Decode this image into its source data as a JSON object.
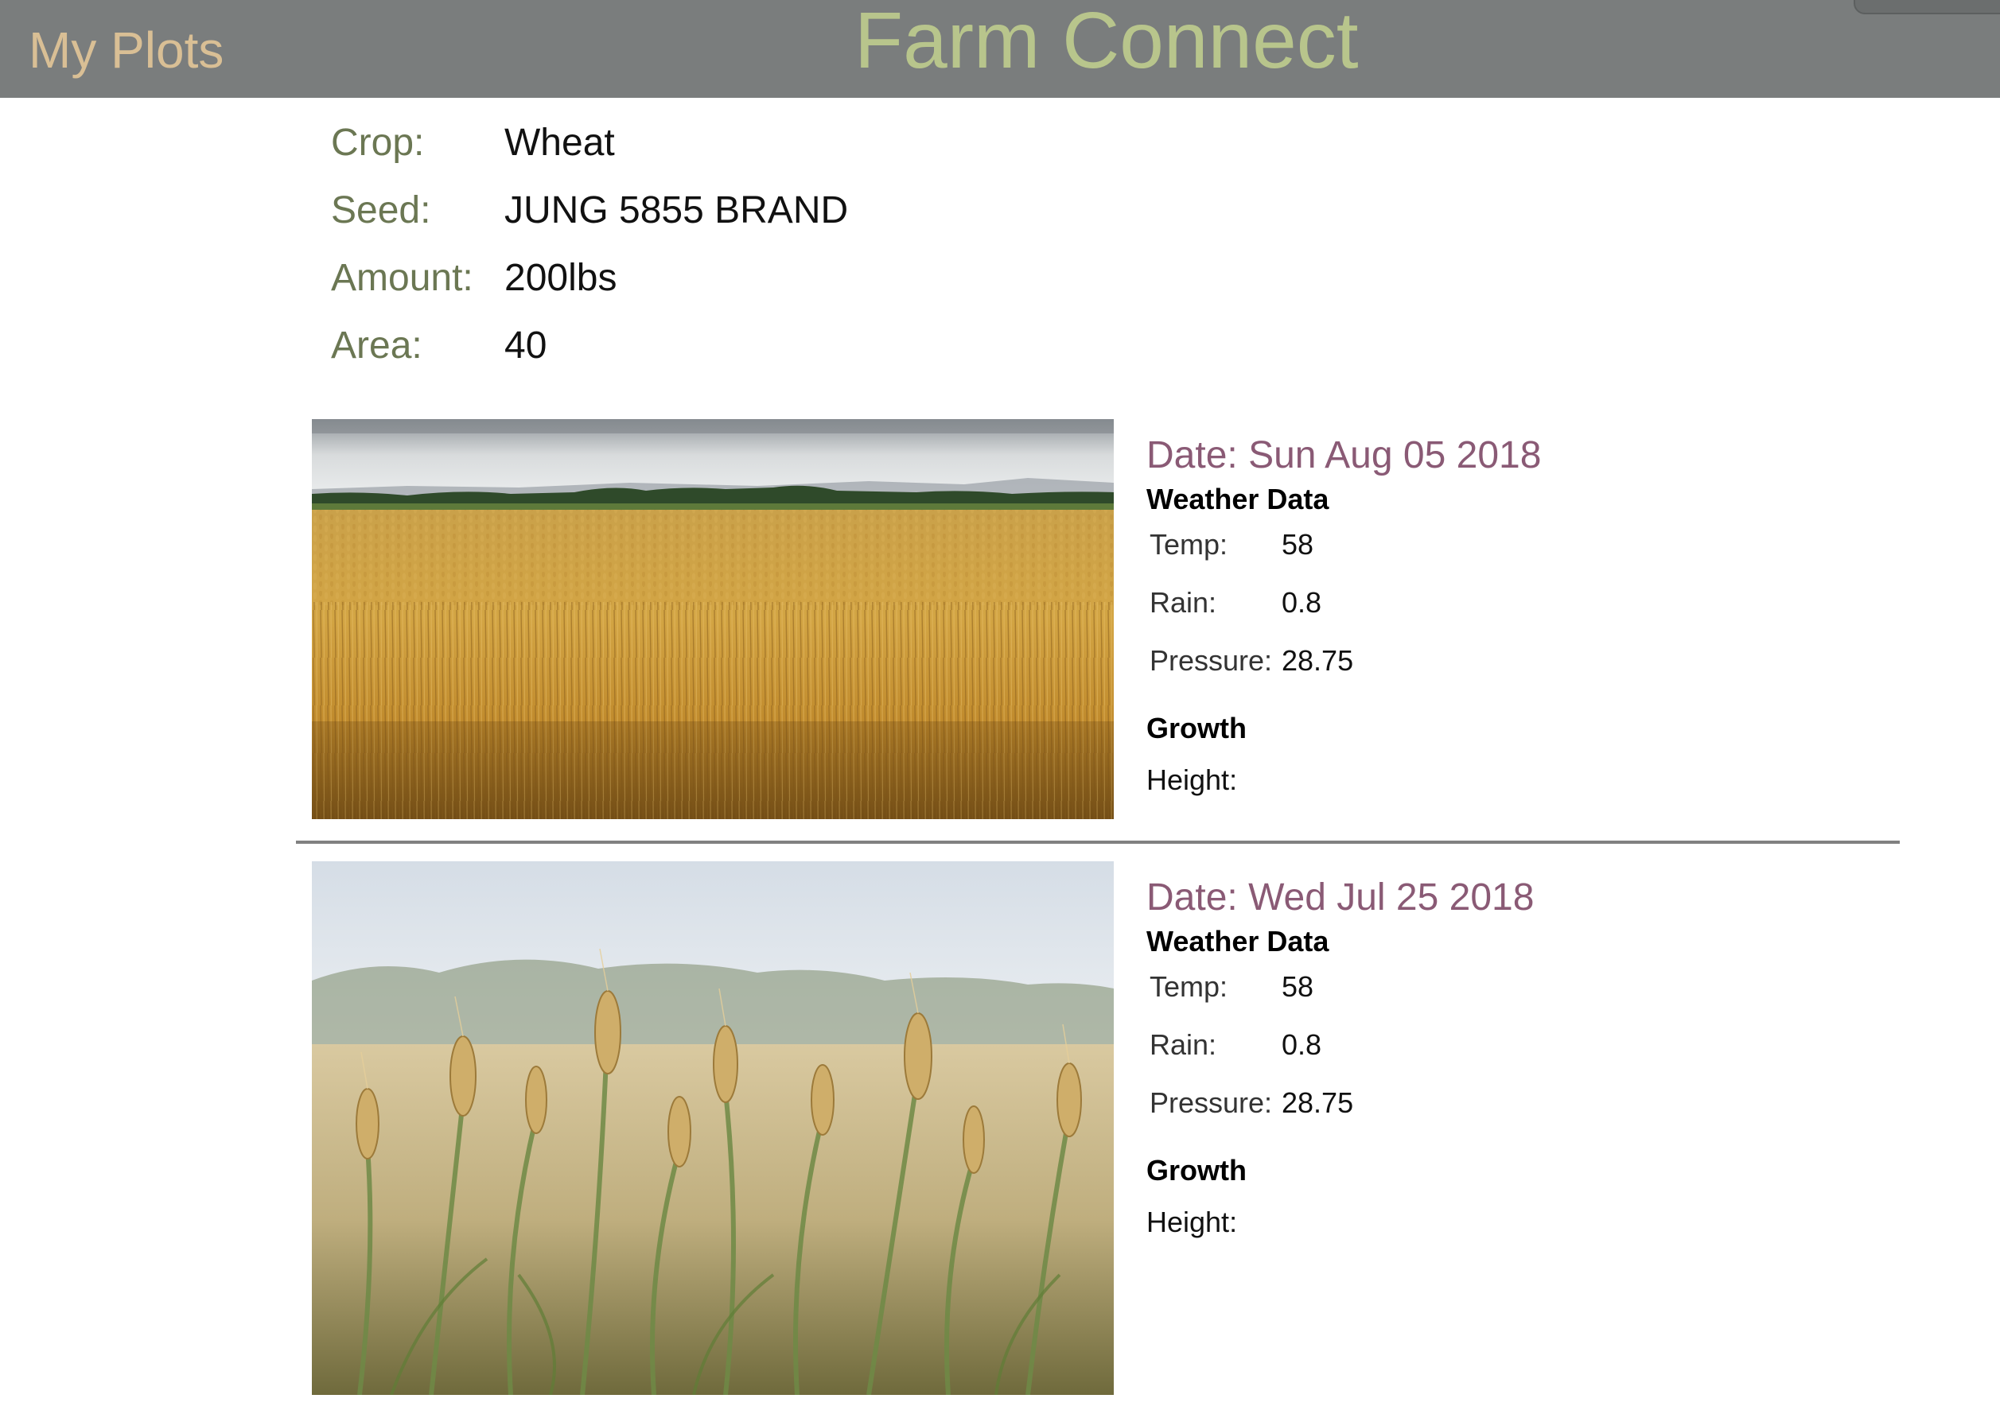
{
  "header": {
    "nav_link": "My Plots",
    "title": "Farm Connect"
  },
  "plot": {
    "crop_label": "Crop:",
    "crop_value": "Wheat",
    "seed_label": "Seed:",
    "seed_value": "JUNG 5855 BRAND",
    "amount_label": "Amount:",
    "amount_value": "200lbs",
    "area_label": "Area:",
    "area_value": "40"
  },
  "entries": [
    {
      "date": "Date: Sun Aug 05 2018",
      "weather_heading": "Weather Data",
      "temp_label": "Temp:",
      "temp_value": "58",
      "rain_label": "Rain:",
      "rain_value": "0.8",
      "pressure_label": "Pressure:",
      "pressure_value": "28.75",
      "growth_heading": "Growth",
      "height_label": "Height:"
    },
    {
      "date": "Date: Wed Jul 25 2018",
      "weather_heading": "Weather Data",
      "temp_label": "Temp:",
      "temp_value": "58",
      "rain_label": "Rain:",
      "rain_value": "0.8",
      "pressure_label": "Pressure:",
      "pressure_value": "28.75",
      "growth_heading": "Growth",
      "height_label": "Height:"
    }
  ],
  "colors": {
    "header_bg": "#7a7d7d",
    "nav_link": "#d9bf95",
    "title": "#b8c58c",
    "label": "#6b7753",
    "date": "#8a5a75"
  }
}
